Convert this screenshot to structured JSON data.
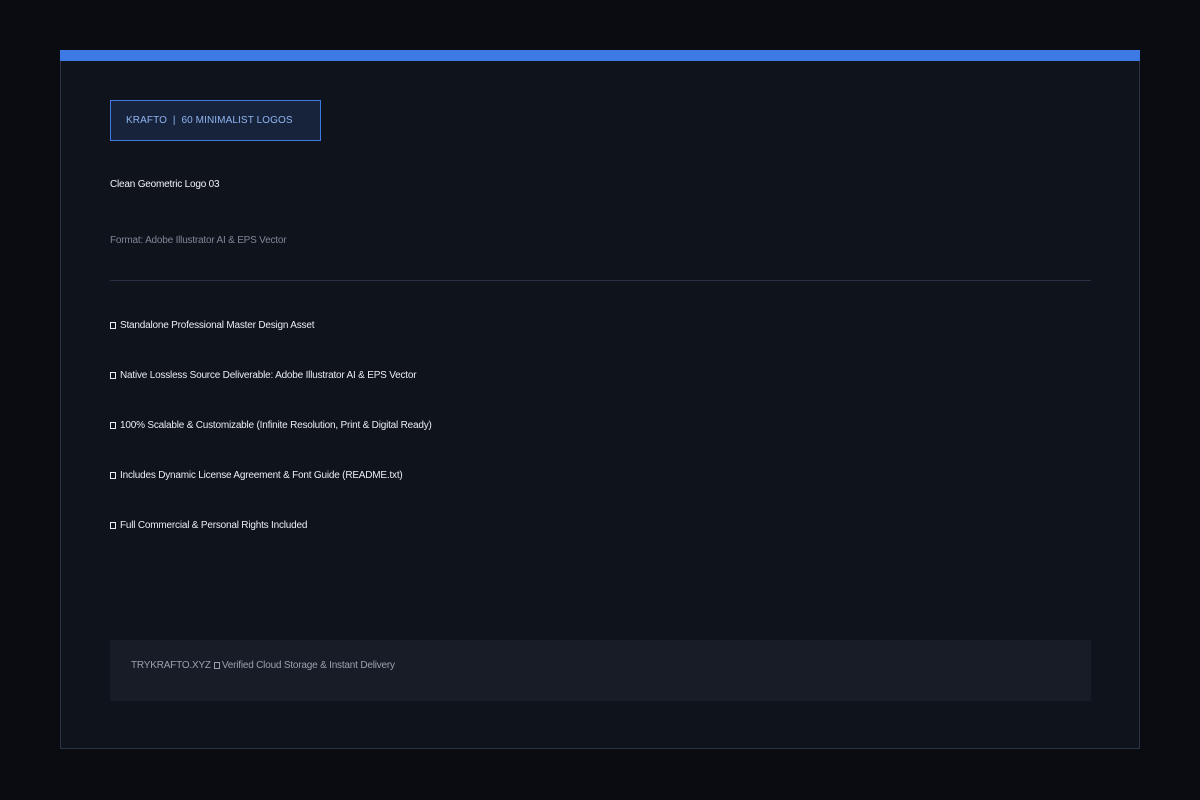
{
  "colors": {
    "background": "#0a0c11",
    "card": "#0f131c",
    "accent": "#3d7ae6",
    "footer": "#181c27"
  },
  "tag": {
    "brand": "KRAFTO",
    "separator": "|",
    "collection": "60 MINIMALIST LOGOS"
  },
  "title": "Clean Geometric Logo 03",
  "format": "Format: Adobe Illustrator AI & EPS Vector",
  "features": [
    {
      "icon": "check-box-icon",
      "text": "Standalone Professional Master Design Asset"
    },
    {
      "icon": "check-box-icon",
      "text": "Native Lossless Source Deliverable: Adobe Illustrator AI & EPS Vector"
    },
    {
      "icon": "check-box-icon",
      "text": "100% Scalable & Customizable (Infinite Resolution, Print & Digital Ready)"
    },
    {
      "icon": "check-box-icon",
      "text": "Includes Dynamic License Agreement & Font Guide (README.txt)"
    },
    {
      "icon": "check-box-icon",
      "text": "Full Commercial & Personal Rights Included"
    }
  ],
  "footer": {
    "site": "TRYKRAFTO.XYZ",
    "text": "Verified Cloud Storage & Instant Delivery"
  }
}
